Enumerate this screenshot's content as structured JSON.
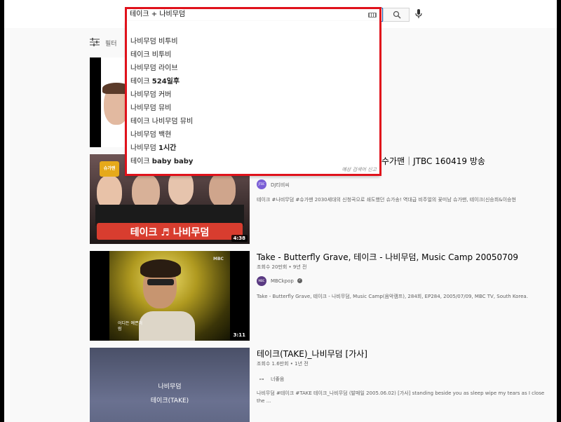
{
  "search": {
    "query": "테이크 + 나비무덤"
  },
  "filter": {
    "label": "필터"
  },
  "suggestions": [
    {
      "prefix": "나비무덤 비투비",
      "bold": ""
    },
    {
      "prefix": "테이크 비투비",
      "bold": ""
    },
    {
      "prefix": "나비무덤 라이브",
      "bold": ""
    },
    {
      "prefix": "테이크 ",
      "bold": "524일후"
    },
    {
      "prefix": "나비무덤 커버",
      "bold": ""
    },
    {
      "prefix": "나비무덤 뮤비",
      "bold": ""
    },
    {
      "prefix": "테이크 나비무덤 뮤비",
      "bold": ""
    },
    {
      "prefix": "나비무덤 백현",
      "bold": ""
    },
    {
      "prefix": "나비무덤 ",
      "bold": "1시간"
    },
    {
      "prefix": "테이크 ",
      "bold": "baby baby"
    }
  ],
  "report_label": "예상 검색어 신고",
  "videos": [
    {
      "title": "",
      "meta": "",
      "channel": "",
      "desc": "",
      "duration": ""
    },
    {
      "title": "수가맨｜JTBC 160419 방송",
      "meta": "",
      "channel": "DJ티비씨",
      "avatar_text": "JTBC",
      "desc": "테이크 #나비무덤 #슈가맨 2030세대의 신청곡으로 쇄도했던 슈가송! 역대급 비주얼의 꽃미남 슈가맨, 테이크(신승희&이승현",
      "duration": "4:38",
      "thumb_caption": "테이크 ♬ 나비무덤",
      "thumb_badge": "슈가맨"
    },
    {
      "title": "Take - Butterfly Grave, 테이크 - 나비무덤, Music Camp 20050709",
      "meta": "조회수 20만회 • 9년 전",
      "channel": "MBCkpop",
      "avatar_text": "MBC",
      "desc": "Take - Butterfly Grave, 테이크 - 나비무덤, Music Camp(음악캠프), 284회, EP284, 2005/07/09, MBC TV, South Korea.",
      "duration": "3:11",
      "thumb_logo": "MBC",
      "thumb_caption": "어디든 예쁜처럼"
    },
    {
      "title": "테이크(TAKE)_나비무덤 [가사]",
      "meta": "조회수 1.6만회 • 1년 전",
      "channel": "너좋음",
      "desc": "나비무덤 #테이크 #TAKE 테이크_나비무덤 (발매일 2005.06.02) [가사] standing beside you as sleep wipe my tears as I close the ...",
      "duration": "",
      "thumb_line1": "나비무덤",
      "thumb_line2": "테이크(TAKE)"
    }
  ]
}
